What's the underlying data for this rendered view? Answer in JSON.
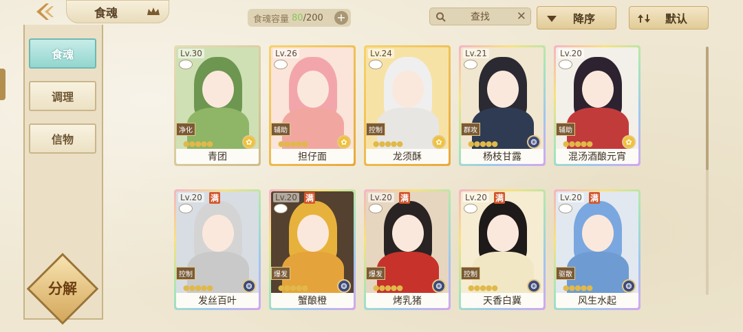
{
  "header": {
    "title": "食魂",
    "capacity_label": "食魂容量",
    "capacity_current": "80",
    "capacity_max": "/200",
    "capacity_add": "+",
    "search_text": "查找",
    "search_clear": "✕",
    "sort_label": "降序",
    "default_label": "默认"
  },
  "sidebar": {
    "items": [
      {
        "label": "食魂",
        "active": true
      },
      {
        "label": "调理",
        "active": false
      },
      {
        "label": "信物",
        "active": false
      }
    ],
    "decompose_label": "分解"
  },
  "cards": [
    {
      "level": "Lv.30",
      "name": "青团",
      "role": "净化",
      "full": "",
      "stars": "●●●●●",
      "element": "sun",
      "frame": "green",
      "accent": "#8fb566",
      "hair": "#6d9650",
      "bg": "#cfe0b5"
    },
    {
      "level": "Lv.26",
      "name": "担仔面",
      "role": "辅助",
      "full": "",
      "stars": "●●●●●",
      "element": "sun",
      "frame": "gold",
      "accent": "#f1a7a0",
      "hair": "#f2a6ab",
      "bg": "#fbe4d9"
    },
    {
      "level": "Lv.24",
      "name": "龙须酥",
      "role": "控制",
      "full": "",
      "stars": "●●●●●",
      "element": "sun",
      "frame": "gold",
      "accent": "#e8e6e2",
      "hair": "#efefef",
      "bg": "#f7e2a6"
    },
    {
      "level": "Lv.21",
      "name": "杨枝甘露",
      "role": "群攻",
      "full": "",
      "stars": "●●●●●",
      "element": "moon",
      "frame": "rainbow",
      "accent": "#2f3b52",
      "hair": "#2b2a33",
      "bg": "#f1e6cf"
    },
    {
      "level": "Lv.20",
      "name": "混汤酒酿元宵",
      "role": "辅助",
      "full": "",
      "stars": "●●●●●",
      "element": "sun",
      "frame": "rainbow",
      "accent": "#c23b3b",
      "hair": "#2d2230",
      "bg": "#f3efe9"
    },
    {
      "level": "Lv.20",
      "name": "发丝百叶",
      "role": "控制",
      "full": "满",
      "stars": "●●●●●",
      "element": "moon",
      "frame": "rainbow",
      "accent": "#c9c9c9",
      "hair": "#d4d4d4",
      "bg": "#d8dde3"
    },
    {
      "level": "Lv.20",
      "name": "蟹酿橙",
      "role": "爆发",
      "full": "满",
      "stars": "●●●●●",
      "element": "moon",
      "frame": "rainbow",
      "accent": "#e5a33b",
      "hair": "#e7b23c",
      "bg": "#54412f"
    },
    {
      "level": "Lv.20",
      "name": "烤乳猪",
      "role": "爆发",
      "full": "满",
      "stars": "●●●●●",
      "element": "moon",
      "frame": "rainbow",
      "accent": "#c7322b",
      "hair": "#2a2323",
      "bg": "#e6d6c0"
    },
    {
      "level": "Lv.20",
      "name": "天香白冀",
      "role": "控制",
      "full": "满",
      "stars": "●●●●●",
      "element": "moon",
      "frame": "rainbow",
      "accent": "#f1e7c4",
      "hair": "#1e1a1a",
      "bg": "#f5ecd2"
    },
    {
      "level": "Lv.20",
      "name": "风生水起",
      "role": "驱散",
      "full": "满",
      "stars": "●●●●●",
      "element": "moon",
      "frame": "rainbow",
      "accent": "#6e9bd2",
      "hair": "#7aa7df",
      "bg": "#e2e8ef"
    }
  ],
  "colors": {
    "active_tab": "#93d6cf",
    "full_badge": "#d2572d",
    "capacity_current": "#86c75a"
  }
}
